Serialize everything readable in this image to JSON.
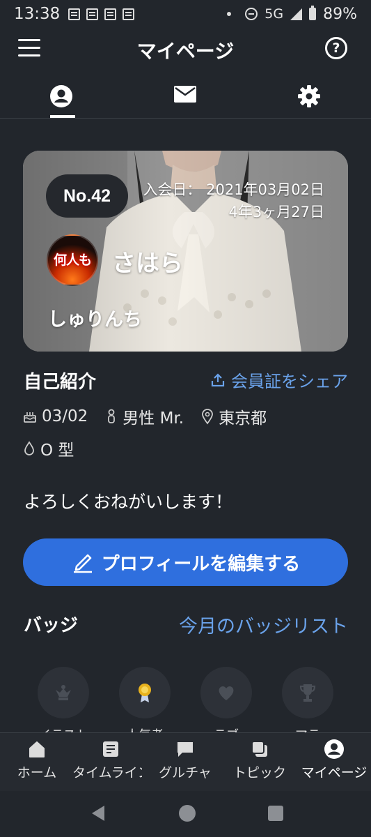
{
  "status_bar": {
    "time": "13:38",
    "network": "5G",
    "battery": "89%"
  },
  "header": {
    "title": "マイページ",
    "help_glyph": "?"
  },
  "tabs": [
    {
      "name": "profile",
      "icon": "person-circle-icon"
    },
    {
      "name": "messages",
      "icon": "mail-icon"
    },
    {
      "name": "settings",
      "icon": "gear-icon"
    }
  ],
  "profile": {
    "member_no": "No.42",
    "join_date": "入会日： 2021年03月02日",
    "duration": "4年3ヶ月27日",
    "avatar_text": "何人も",
    "display_name": "さはら",
    "sub_name": "しゅりんち"
  },
  "intro": {
    "title": "自己紹介",
    "share_label": "会員証をシェア",
    "birthday": "03/02",
    "gender": "男性 Mr.",
    "location": "東京都",
    "blood_type": "O 型",
    "bio": "よろしくおねがいします！"
  },
  "edit_button": {
    "label": "プロフィールを編集する"
  },
  "badges": {
    "title": "バッジ",
    "list_link": "今月のバッジリスト",
    "items": [
      {
        "icon": "crown-icon",
        "label": "イラスト"
      },
      {
        "icon": "medal-icon",
        "label": "人気者"
      },
      {
        "icon": "heart-icon",
        "label": "ラブ"
      },
      {
        "icon": "trophy-icon",
        "label": "マラ"
      }
    ]
  },
  "bottom_nav": [
    {
      "label": "ホーム",
      "icon": "home-icon"
    },
    {
      "label": "タイムライン",
      "icon": "timeline-icon"
    },
    {
      "label": "グルチャ",
      "icon": "chat-icon"
    },
    {
      "label": "トピック",
      "icon": "topic-icon"
    },
    {
      "label": "マイページ",
      "icon": "mypage-icon"
    }
  ],
  "colors": {
    "background": "#22262c",
    "accent": "#2f6fde",
    "link": "#6aa2ea"
  }
}
